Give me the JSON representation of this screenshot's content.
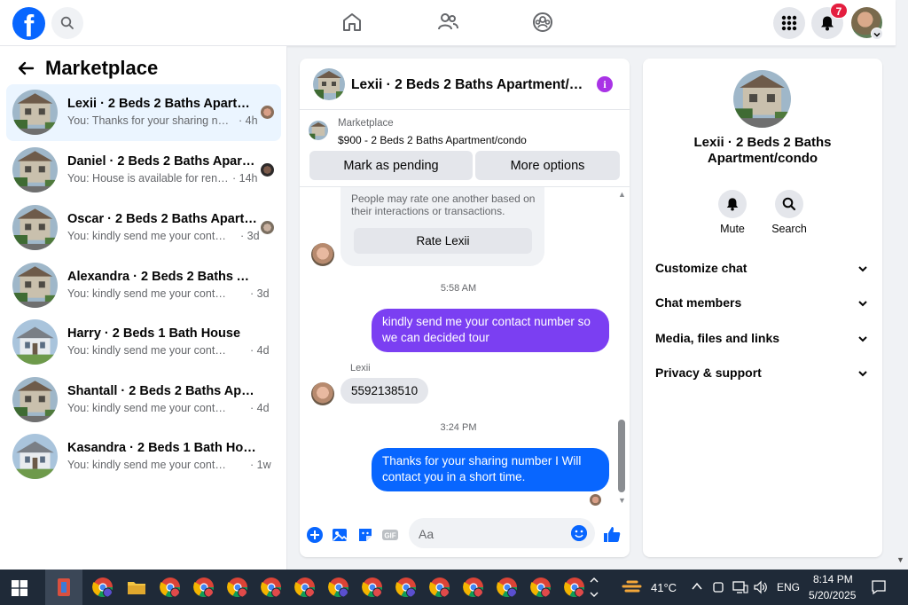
{
  "colors": {
    "brand": "#0866ff",
    "bubble_purple": "#7b3ff2",
    "bubble_blue": "#0866ff",
    "notification_badge": "#e41e3f",
    "active_row": "#ebf5ff"
  },
  "topbar": {
    "logo_letter": "f",
    "notification_count": "7",
    "icons": [
      "facebook-logo",
      "search-icon",
      "home-icon",
      "friends-icon",
      "groups-icon",
      "menu-grid-icon",
      "bell-icon",
      "account-avatar"
    ]
  },
  "sidebar": {
    "title": "Marketplace",
    "conversations": [
      {
        "name": "Lexii · 2 Beds 2 Baths Apartment/condo",
        "snippet": "You: Thanks for your sharing numb...",
        "time": "· 4h",
        "thumb": "condo"
      },
      {
        "name": "Daniel · 2 Beds 2 Baths Apartment/condo",
        "snippet": "You: House is available for rent se...",
        "time": "· 14h",
        "thumb": "condo"
      },
      {
        "name": "Oscar · 2 Beds 2 Baths Apartment/condo",
        "snippet": "You: kindly send me your contact n...",
        "time": "· 3d",
        "thumb": "condo"
      },
      {
        "name": "Alexandra · 2 Beds 2 Baths Apartment/condo",
        "snippet": "You: kindly send me your contact nu...",
        "time": "· 3d",
        "thumb": "condo"
      },
      {
        "name": "Harry · 2 Beds 1 Bath House",
        "snippet": "You: kindly send me your contact nu...",
        "time": "· 4d",
        "thumb": "house"
      },
      {
        "name": "Shantall · 2 Beds 2 Baths Apartment/condo",
        "snippet": "You: kindly send me your contact nu...",
        "time": "· 4d",
        "thumb": "condo"
      },
      {
        "name": "Kasandra · 2 Beds 1 Bath House",
        "snippet": "You: kindly send me your contact nu...",
        "time": "· 1w",
        "thumb": "house"
      }
    ]
  },
  "chat": {
    "title": "Lexii · 2 Beds 2 Baths Apartment/condo",
    "info_glyph": "i",
    "listing_label": "Marketplace",
    "listing_desc": "$900 - 2 Beds 2 Baths Apartment/condo",
    "pending_label": "Mark as pending",
    "more_options_label": "More options",
    "system_text": "People may rate one another based on their interactions or transactions.",
    "rate_label": "Rate Lexii",
    "time1": "5:58 AM",
    "msg_out_1": "kindly send me your contact number so we can decided tour",
    "sender_name": "Lexii",
    "msg_in_1": "5592138510",
    "time2": "3:24 PM",
    "msg_out_2": "Thanks for your sharing number I Will contact you in a short time.",
    "composer_placeholder": "Aa"
  },
  "details": {
    "title": "Lexii · 2 Beds 2 Baths Apartment/condo",
    "mute_label": "Mute",
    "search_label": "Search",
    "sections": [
      "Customize chat",
      "Chat members",
      "Media, files and links",
      "Privacy & support"
    ]
  },
  "taskbar": {
    "temperature": "41°C",
    "language": "ENG",
    "time": "8:14 PM",
    "date": "5/20/2025"
  }
}
